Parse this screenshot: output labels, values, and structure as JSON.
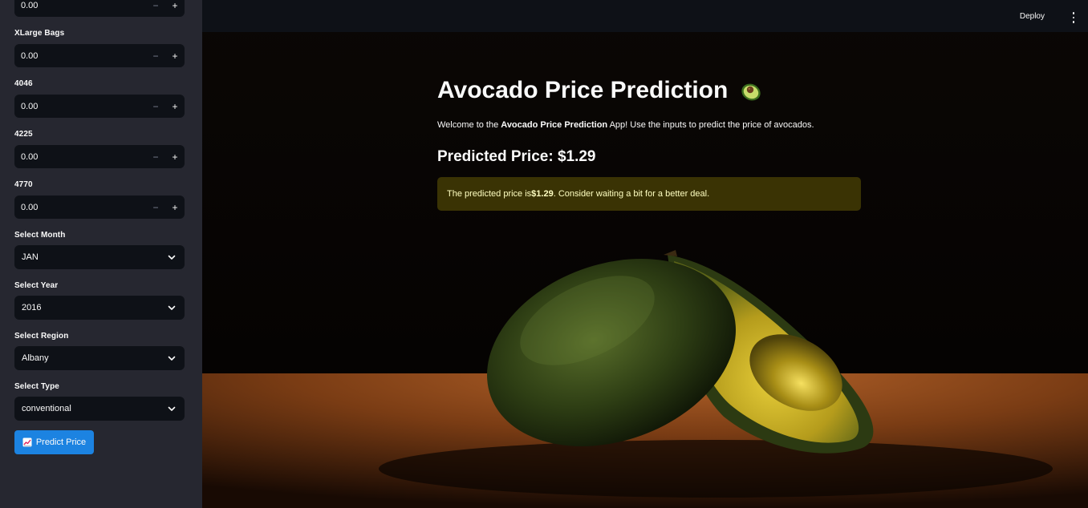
{
  "sidebar": {
    "top_input": {
      "value": "0.00"
    },
    "xlarge_bags": {
      "label": "XLarge Bags",
      "value": "0.00"
    },
    "plu_4046": {
      "label": "4046",
      "value": "0.00"
    },
    "plu_4225": {
      "label": "4225",
      "value": "0.00"
    },
    "plu_4770": {
      "label": "4770",
      "value": "0.00"
    },
    "month": {
      "label": "Select Month",
      "value": "JAN"
    },
    "year": {
      "label": "Select Year",
      "value": "2016"
    },
    "region": {
      "label": "Select Region",
      "value": "Albany"
    },
    "type": {
      "label": "Select Type",
      "value": "conventional"
    },
    "stepper_minus": "−",
    "stepper_plus": "+",
    "predict_button": {
      "label": "Predict Price",
      "icon": "chart-increasing-icon"
    }
  },
  "toolbar": {
    "deploy_label": "Deploy"
  },
  "main": {
    "title": "Avocado Price Prediction",
    "title_icon": "avocado-icon",
    "welcome_prefix": "Welcome to the ",
    "welcome_bold": "Avocado Price Prediction",
    "welcome_suffix": " App! Use the inputs to predict the price of avocados.",
    "predicted_heading": "Predicted Price: $1.29",
    "alert_prefix": "The predicted price is ",
    "alert_bold": "$1.29",
    "alert_suffix": ". Consider waiting a bit for a better deal."
  },
  "colors": {
    "sidebar_bg": "#262730",
    "main_bg": "#0e1117",
    "primary_button": "#1c83e1",
    "warning_bg": "#3a3304",
    "warning_text": "#ffffc2"
  }
}
